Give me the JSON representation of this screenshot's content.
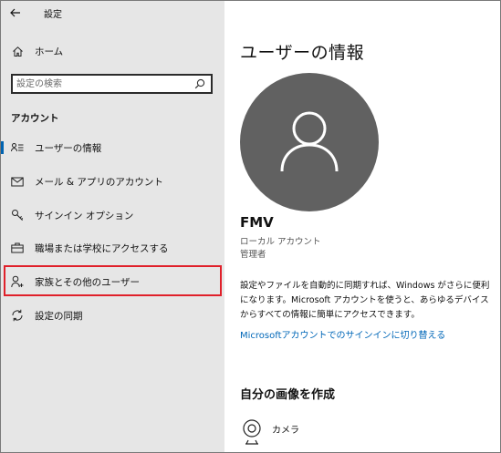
{
  "window": {
    "title": "設定",
    "back_icon": "arrow-left-icon"
  },
  "sidebar": {
    "home_label": "ホーム",
    "search_placeholder": "設定の検索",
    "section_title": "アカウント",
    "items": [
      {
        "label": "ユーザーの情報",
        "icon": "user-info-icon",
        "active": true
      },
      {
        "label": "メール & アプリのアカウント",
        "icon": "mail-icon"
      },
      {
        "label": "サインイン オプション",
        "icon": "key-icon"
      },
      {
        "label": "職場または学校にアクセスする",
        "icon": "briefcase-icon"
      },
      {
        "label": "家族とその他のユーザー",
        "icon": "person-add-icon",
        "highlighted": true
      },
      {
        "label": "設定の同期",
        "icon": "sync-icon"
      }
    ]
  },
  "main": {
    "title": "ユーザーの情報",
    "user_name": "FMV",
    "account_type": "ローカル アカウント",
    "role": "管理者",
    "description": "設定やファイルを自動的に同期すれば、Windows がさらに便利になります。Microsoft アカウントを使うと、あらゆるデバイスからすべての情報に簡単にアクセスできます。",
    "link_label": "Microsoftアカウントでのサインインに切り替える",
    "picture_section_title": "自分の画像を作成",
    "camera_label": "カメラ"
  },
  "colors": {
    "sidebar_bg": "#e6e6e6",
    "accent": "#0063b1",
    "link": "#0067b8",
    "avatar_bg": "#616161",
    "highlight_border": "#e0202a"
  }
}
